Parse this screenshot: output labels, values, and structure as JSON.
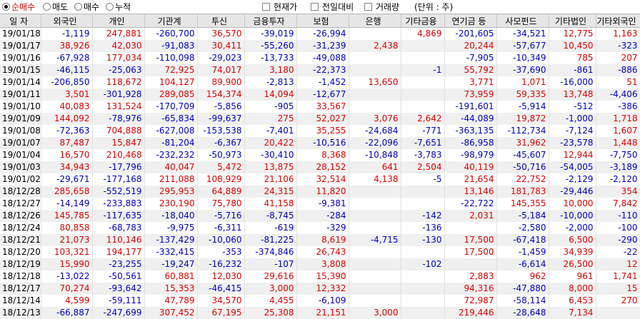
{
  "toolbar": {
    "radios": [
      {
        "label": "순매수",
        "selected": true
      },
      {
        "label": "매도",
        "selected": false
      },
      {
        "label": "매수",
        "selected": false
      },
      {
        "label": "누적",
        "selected": false
      }
    ],
    "checks": [
      {
        "label": "현재가",
        "checked": false
      },
      {
        "label": "전일대비",
        "checked": false
      },
      {
        "label": "거래량",
        "checked": false
      }
    ],
    "unit": "(단위 : 주)"
  },
  "colors": {
    "positive": "#e00000",
    "negative": "#0000c8",
    "header_bg": "#e6e6e6",
    "alt_row": "#f0f0f0"
  },
  "columns": [
    "일 자",
    "외국인",
    "개인",
    "기관계",
    "투신",
    "금융투자",
    "보험",
    "은행",
    "기타금융",
    "연기금 등",
    "사모펀드",
    "기타법인",
    "기타외국인"
  ],
  "rows": [
    [
      "19/01/18",
      "-1,119",
      "247,881",
      "-260,700",
      "36,570",
      "-39,019",
      "-26,994",
      "",
      "4,869",
      "-201,605",
      "-34,521",
      "12,775",
      "1,163"
    ],
    [
      "19/01/17",
      "38,926",
      "42,030",
      "-91,083",
      "30,411",
      "-55,260",
      "-31,239",
      "2,438",
      "",
      "20,244",
      "-57,677",
      "10,450",
      "-323"
    ],
    [
      "19/01/16",
      "-67,928",
      "177,034",
      "-110,098",
      "-29,023",
      "-13,733",
      "-49,088",
      "",
      "",
      "-7,905",
      "-10,349",
      "785",
      "207"
    ],
    [
      "19/01/15",
      "-46,115",
      "-25,063",
      "72,925",
      "74,017",
      "3,180",
      "-22,373",
      "",
      "-1",
      "55,792",
      "-37,690",
      "-861",
      "-886"
    ],
    [
      "19/01/14",
      "-206,850",
      "118,672",
      "104,127",
      "89,900",
      "-2,813",
      "-1,452",
      "13,650",
      "",
      "3,771",
      "1,071",
      "-16,000",
      "51"
    ],
    [
      "19/01/11",
      "3,501",
      "-301,928",
      "289,085",
      "154,374",
      "14,094",
      "-12,677",
      "",
      "",
      "73,959",
      "59,335",
      "13,748",
      "-4,406"
    ],
    [
      "19/01/10",
      "40,083",
      "131,524",
      "-170,709",
      "-5,856",
      "-905",
      "33,567",
      "",
      "",
      "-191,601",
      "-5,914",
      "-512",
      "-386"
    ],
    [
      "19/01/09",
      "144,092",
      "-78,976",
      "-65,834",
      "-99,637",
      "275",
      "52,027",
      "3,076",
      "2,642",
      "-44,089",
      "19,872",
      "-1,000",
      "1,718"
    ],
    [
      "19/01/08",
      "-72,363",
      "704,888",
      "-627,008",
      "-153,538",
      "-7,401",
      "35,255",
      "-24,684",
      "-771",
      "-363,135",
      "-112,734",
      "-7,124",
      "1,607"
    ],
    [
      "19/01/07",
      "87,487",
      "15,847",
      "-81,204",
      "-6,367",
      "20,422",
      "-10,516",
      "-22,096",
      "-7,651",
      "-86,958",
      "31,962",
      "-23,578",
      "1,448"
    ],
    [
      "19/01/04",
      "16,570",
      "210,468",
      "-232,232",
      "-50,973",
      "-30,410",
      "8,368",
      "-10,848",
      "-3,783",
      "-98,979",
      "-45,607",
      "12,944",
      "-7,750"
    ],
    [
      "19/01/03",
      "34,943",
      "-17,796",
      "40,047",
      "5,472",
      "13,875",
      "28,152",
      "641",
      "2,504",
      "40,119",
      "-50,716",
      "-54,005",
      "-3,189"
    ],
    [
      "19/01/02",
      "-29,671",
      "-177,168",
      "211,088",
      "108,929",
      "21,106",
      "32,514",
      "4,138",
      "-5",
      "21,654",
      "22,752",
      "-2,129",
      "-2,120"
    ],
    [
      "18/12/28",
      "285,658",
      "-552,519",
      "295,953",
      "64,889",
      "24,315",
      "11,820",
      "",
      "",
      "13,146",
      "181,783",
      "-29,446",
      "354"
    ],
    [
      "18/12/27",
      "-14,149",
      "-233,883",
      "230,190",
      "75,780",
      "41,158",
      "-9,381",
      "",
      "",
      "-22,722",
      "145,355",
      "10,000",
      "7,842"
    ],
    [
      "18/12/26",
      "145,785",
      "-117,635",
      "-18,040",
      "-5,716",
      "-8,745",
      "-284",
      "",
      "-142",
      "2,031",
      "-5,184",
      "-10,000",
      "-110"
    ],
    [
      "18/12/24",
      "80,858",
      "-68,783",
      "-9,975",
      "-6,311",
      "-619",
      "-329",
      "",
      "-136",
      "",
      "-2,580",
      "-2,000",
      "-100"
    ],
    [
      "18/12/21",
      "21,073",
      "110,146",
      "-137,429",
      "-10,060",
      "-81,225",
      "8,619",
      "-4,715",
      "-130",
      "17,500",
      "-67,418",
      "6,500",
      "-290"
    ],
    [
      "18/12/20",
      "103,321",
      "194,177",
      "-332,415",
      "-353",
      "-374,846",
      "26,743",
      "",
      "",
      "17,500",
      "-1,459",
      "34,939",
      "-22"
    ],
    [
      "18/12/19",
      "15,990",
      "-23,255",
      "-19,247",
      "-16,232",
      "-107",
      "3,808",
      "",
      "-102",
      "",
      "-6,614",
      "26,500",
      "12"
    ],
    [
      "18/12/18",
      "-13,022",
      "-50,561",
      "60,881",
      "12,030",
      "29,616",
      "15,390",
      "",
      "",
      "2,883",
      "962",
      "961",
      "1,741"
    ],
    [
      "18/12/17",
      "70,274",
      "-93,642",
      "15,353",
      "-46,415",
      "3,000",
      "12,332",
      "",
      "",
      "94,316",
      "-47,880",
      "8,000",
      "15"
    ],
    [
      "18/12/14",
      "4,599",
      "-59,111",
      "47,789",
      "34,570",
      "4,455",
      "-6,109",
      "",
      "",
      "72,987",
      "-58,114",
      "6,453",
      "270"
    ],
    [
      "18/12/13",
      "-66,887",
      "-247,699",
      "307,452",
      "67,195",
      "25,308",
      "21,151",
      "3,000",
      "",
      "219,446",
      "-28,648",
      "7,134",
      ""
    ]
  ]
}
